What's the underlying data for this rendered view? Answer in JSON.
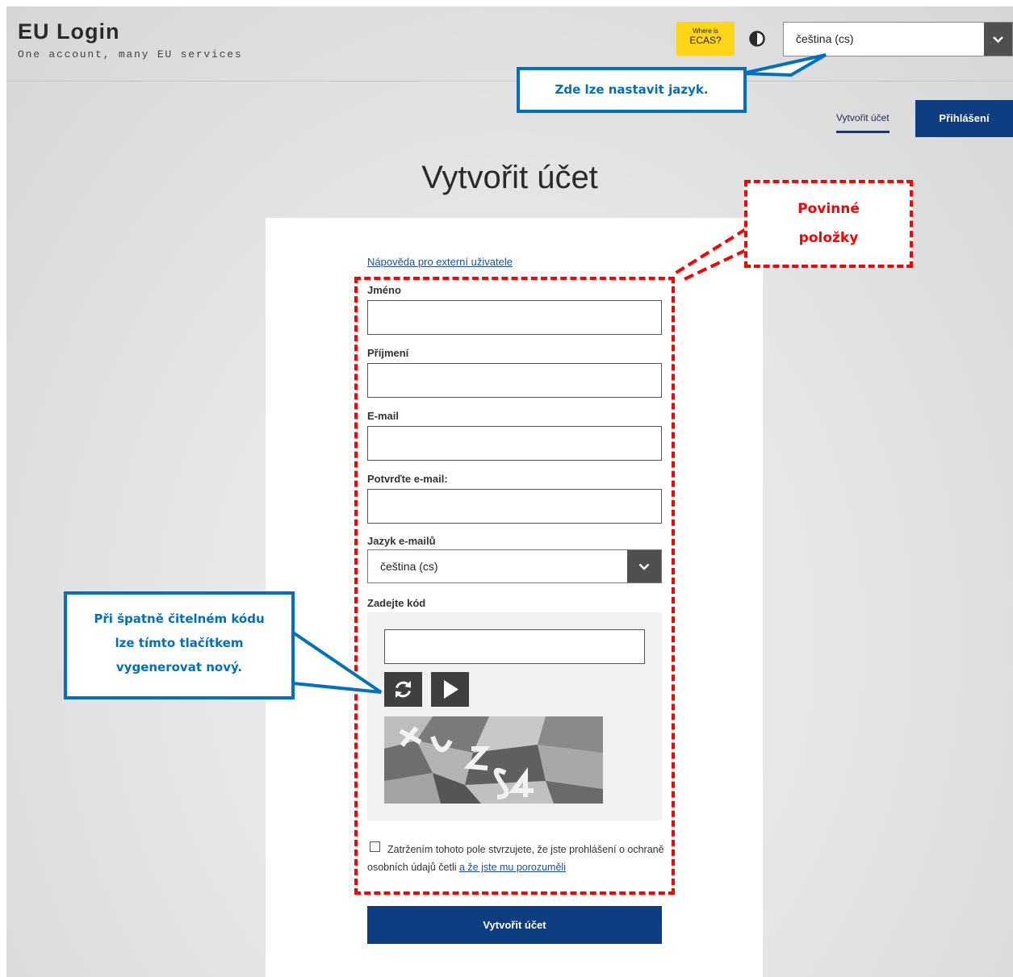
{
  "header": {
    "app_title": "EU Login",
    "app_subtitle": "One account, many EU services",
    "ecas_badge": {
      "line1": "Where is",
      "line2": "ECAS?"
    },
    "language_select": {
      "value": "čeština (cs)"
    }
  },
  "nav": {
    "create_account_link": "Vytvořit účet",
    "login_button": "Přihlášení"
  },
  "page_title": "Vytvořit účet",
  "form": {
    "help_link": "Nápověda pro externí uživatele",
    "first_name": {
      "label": "Jméno",
      "value": ""
    },
    "last_name": {
      "label": "Příjmení",
      "value": ""
    },
    "email": {
      "label": "E-mail",
      "value": ""
    },
    "email_confirm": {
      "label": "Potvrďte e-mail:",
      "value": ""
    },
    "email_language": {
      "label": "Jazyk e-mailů",
      "value": "čeština (cs)"
    },
    "captcha": {
      "label": "Zadejte kód",
      "value": "",
      "refresh_icon": "refresh-icon",
      "play_icon": "play-icon"
    },
    "consent": {
      "text": "Zatržením tohoto pole stvrzujete, že jste prohlášení o ochraně osobních údajů četli ",
      "link": "a že jste mu porozuměli",
      "checked": false
    },
    "submit_button": "Vytvořit účet"
  },
  "annotations": {
    "language_note": "Zde lze nastavit jazyk.",
    "mandatory_note_line1": "Povinné",
    "mandatory_note_line2": "položky",
    "captcha_note_line1": "Při špatně čitelném kódu",
    "captcha_note_line2": "lze tímto tlačítkem",
    "captcha_note_line3": "vygenerovat nový."
  },
  "colors": {
    "brand_blue": "#0e3d82",
    "ecas_yellow": "#ffd617",
    "annotation_blue": "#0070c0",
    "annotation_red": "#ff0000"
  }
}
